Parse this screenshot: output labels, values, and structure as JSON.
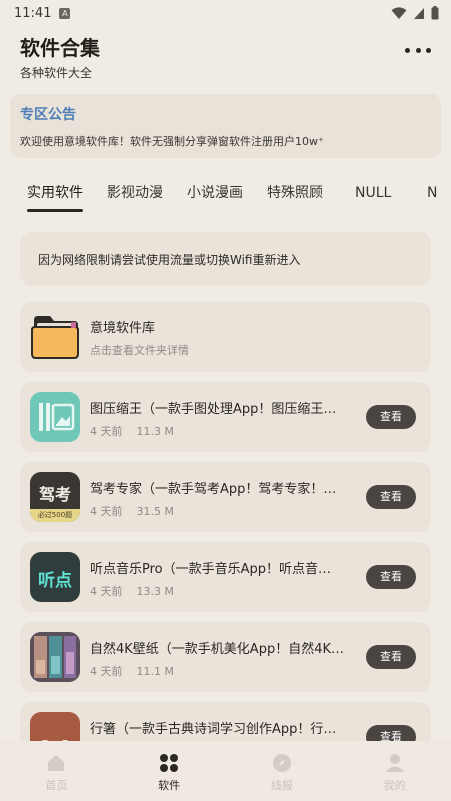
{
  "status_bar": {
    "time": "11:41",
    "sim_label": "A"
  },
  "header": {
    "title": "软件合集",
    "subtitle": "各种软件大全"
  },
  "notice": {
    "title": "专区公告",
    "text": "欢迎使用意境软件库！软件无强制分享弹窗软件注册用户10w⁺"
  },
  "tabs": [
    {
      "label": "实用软件",
      "active": true
    },
    {
      "label": "影视动漫"
    },
    {
      "label": "小说漫画"
    },
    {
      "label": "特殊照顾"
    },
    {
      "label": "NULL"
    },
    {
      "label": "N"
    }
  ],
  "network_message": "因为网络限制请尝试使用流量或切换Wifi重新进入",
  "folder": {
    "name": "意境软件库",
    "desc": "点击查看文件夹详情"
  },
  "apps": [
    {
      "name": "图压缩王（一款手图处理App！图压缩王…",
      "time": "4 天前",
      "size": "11.3 M",
      "button": "查看",
      "icon": "image-compress-icon",
      "icon_color": "#6fc7b8"
    },
    {
      "name": "驾考专家（一款手驾考App！驾考专家！…",
      "time": "4 天前",
      "size": "31.5 M",
      "button": "查看",
      "icon": "driving-exam-icon",
      "icon_color": "#3a3632",
      "icon_text": "驾考",
      "icon_badge": "必过500题"
    },
    {
      "name": "听点音乐Pro（一款手音乐App！听点音…",
      "time": "4 天前",
      "size": "13.3 M",
      "button": "查看",
      "icon": "music-icon",
      "icon_color": "#2f3e3c",
      "icon_text": "听点"
    },
    {
      "name": "自然4K壁纸（一款手机美化App！自然4K…",
      "time": "4 天前",
      "size": "11.1 M",
      "button": "查看",
      "icon": "wallpaper-icon",
      "icon_color": "#7b6a72"
    },
    {
      "name": "行箸（一款手古典诗词学习创作App！行…",
      "time": "",
      "size": "",
      "button": "查看",
      "icon": "poetry-icon",
      "icon_color": "#a65a42"
    }
  ],
  "bottom_nav": [
    {
      "label": "首页",
      "icon": "home-icon"
    },
    {
      "label": "软件",
      "icon": "grid-icon",
      "active": true
    },
    {
      "label": "线报",
      "icon": "compass-icon"
    },
    {
      "label": "我的",
      "icon": "user-icon"
    }
  ],
  "colors": {
    "background": "#f0ebe3",
    "card": "#e9e3da",
    "accent": "#4f7fb6",
    "button": "#4a4540"
  }
}
